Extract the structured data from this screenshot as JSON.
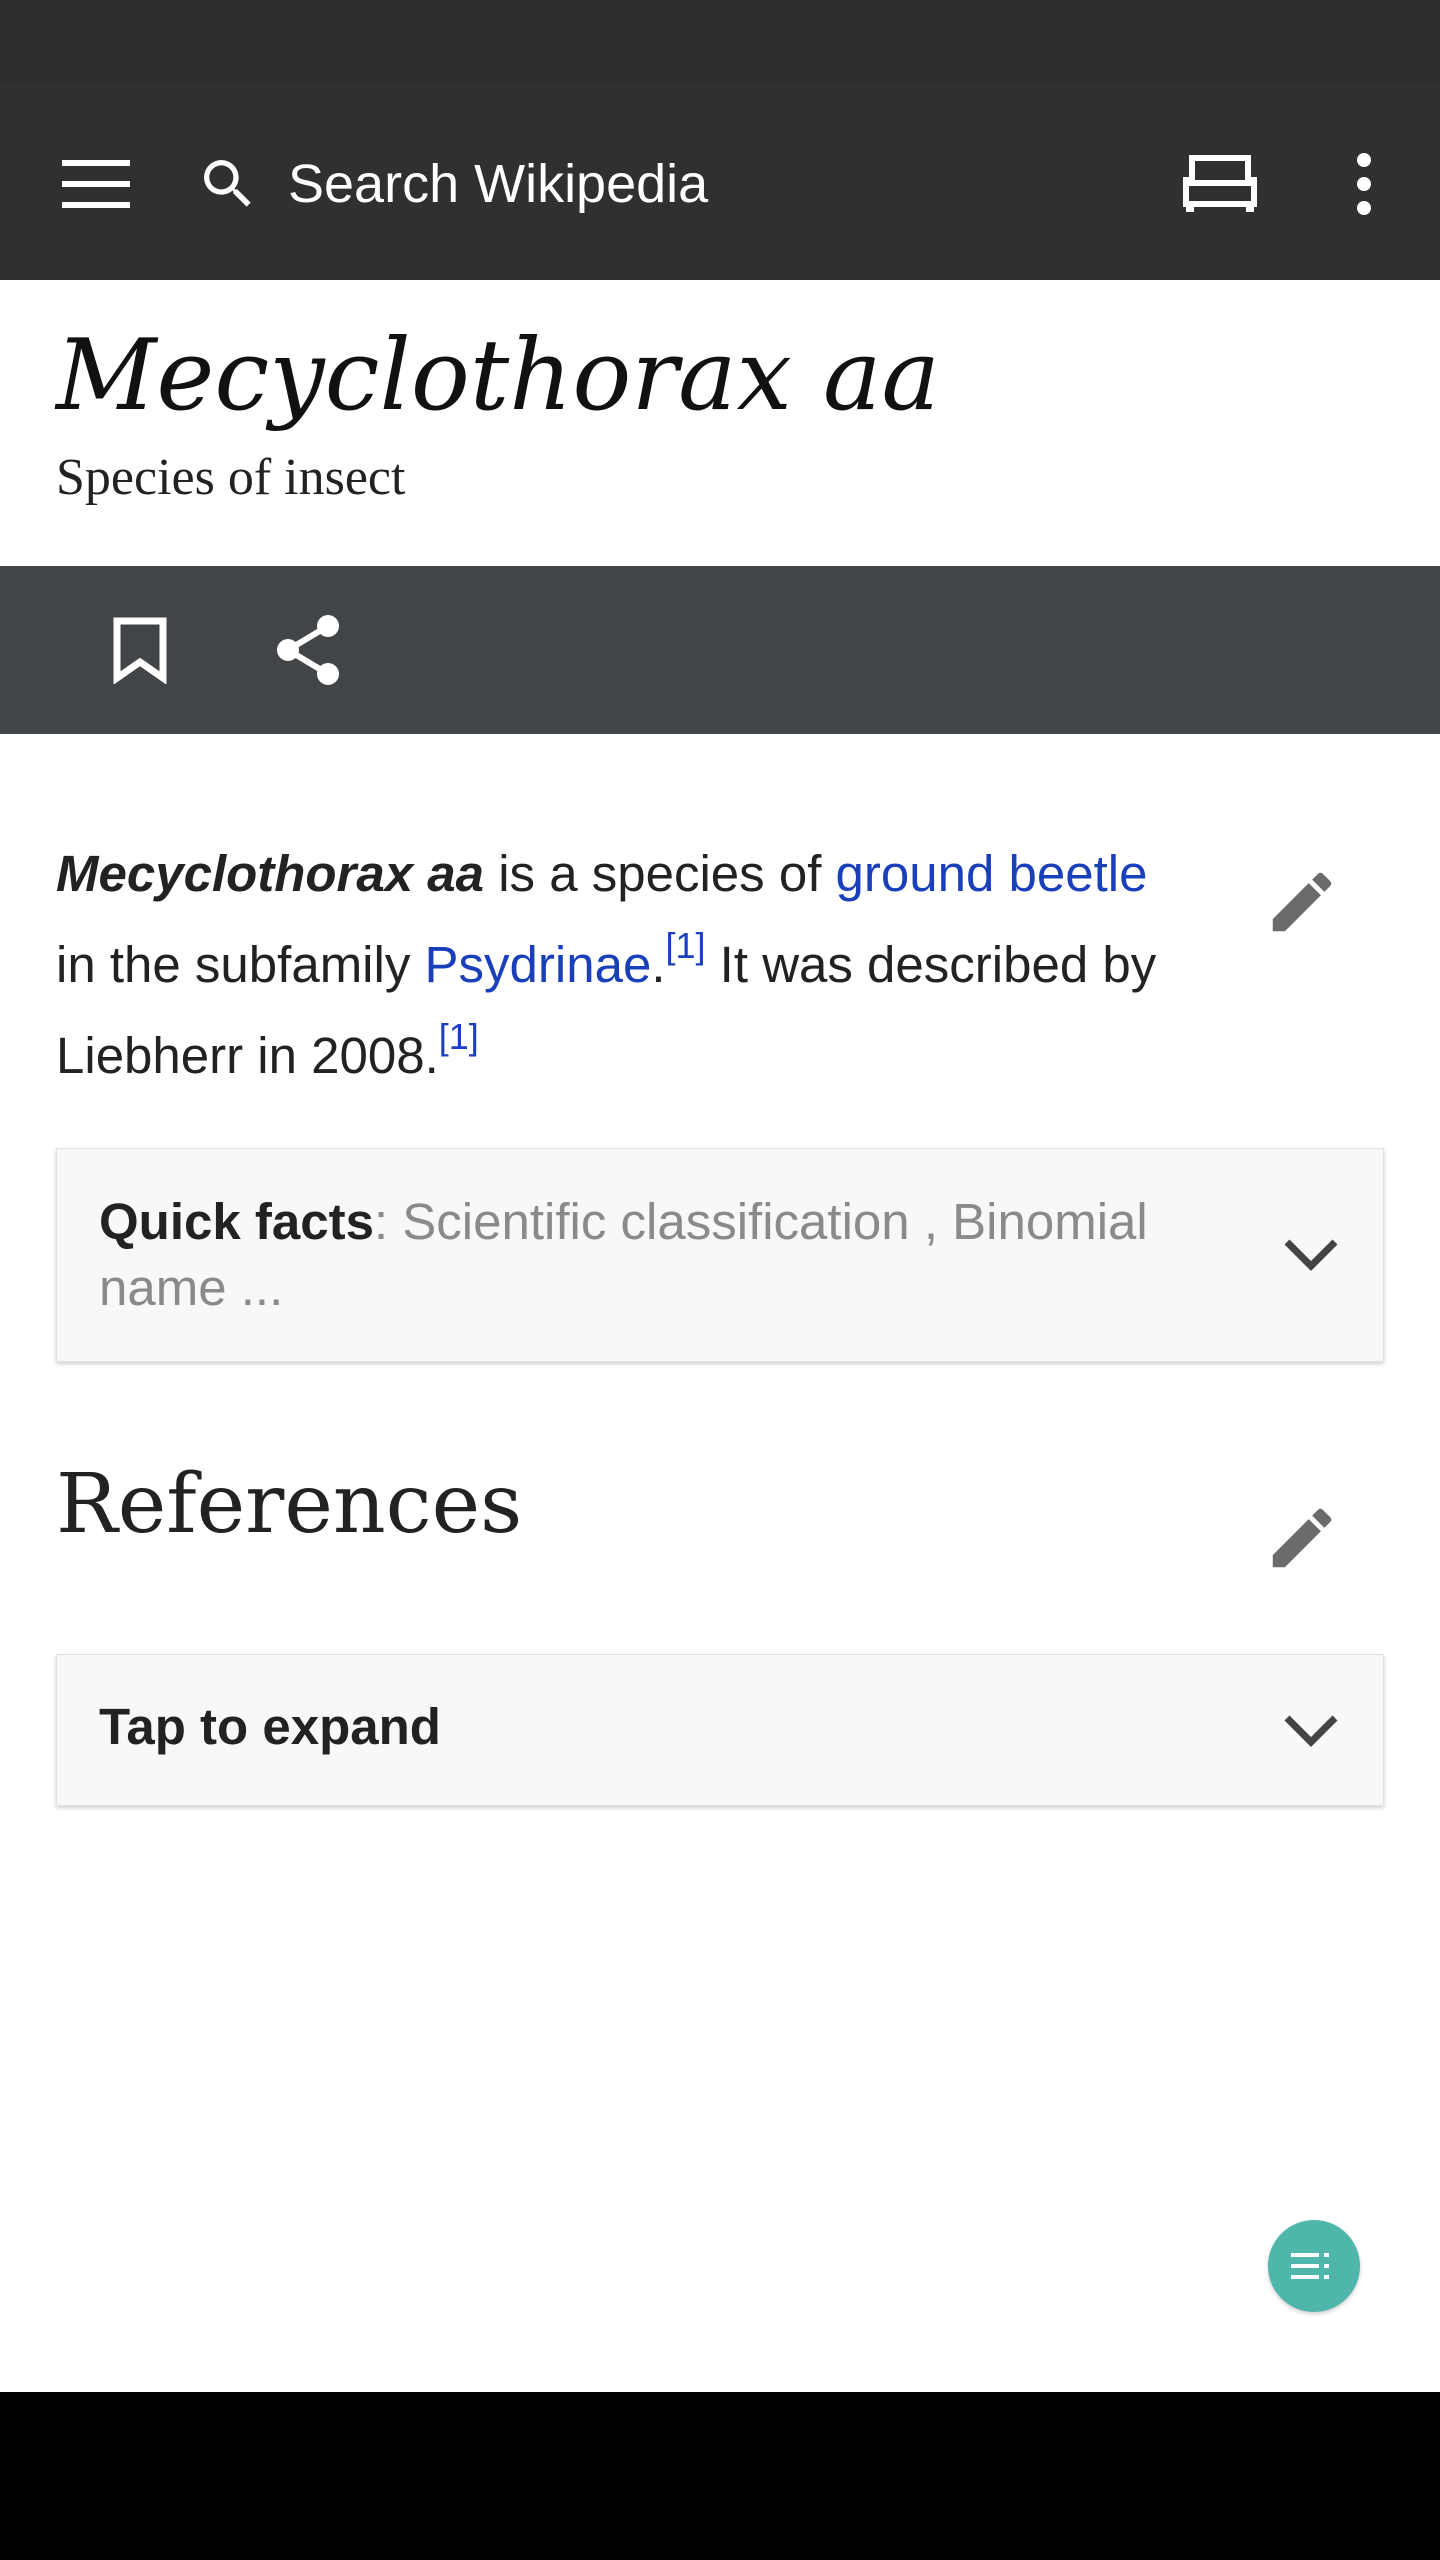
{
  "toolbar": {
    "search_placeholder": "Search Wikipedia",
    "icons": {
      "menu": "menu-icon",
      "search": "search-icon",
      "tabs": "tabs-icon",
      "overflow": "more-vert-icon"
    }
  },
  "page": {
    "title": "Mecyclothorax aa",
    "description": "Species of insect"
  },
  "actions": {
    "icons": [
      "bookmark-icon",
      "share-icon"
    ]
  },
  "lead": {
    "term": "Mecyclothorax aa",
    "text_1": " is a species of ",
    "link_1": "ground beetle",
    "text_2": " in the subfamily ",
    "link_2": "Psydrinae",
    "text_3": ".",
    "ref_1": "[1]",
    "text_4": " It was described by Liebherr in 2008.",
    "ref_2": "[1]"
  },
  "quick_facts": {
    "label": "Quick facts",
    "summary": ": Scientific classification , Binomial name ..."
  },
  "references": {
    "heading": "References",
    "expand_label": "Tap to expand"
  },
  "colors": {
    "toolbar_bg": "#303030",
    "action_bar_bg": "#424548",
    "link": "#1a3fbb",
    "fab": "#4fb6ac"
  }
}
